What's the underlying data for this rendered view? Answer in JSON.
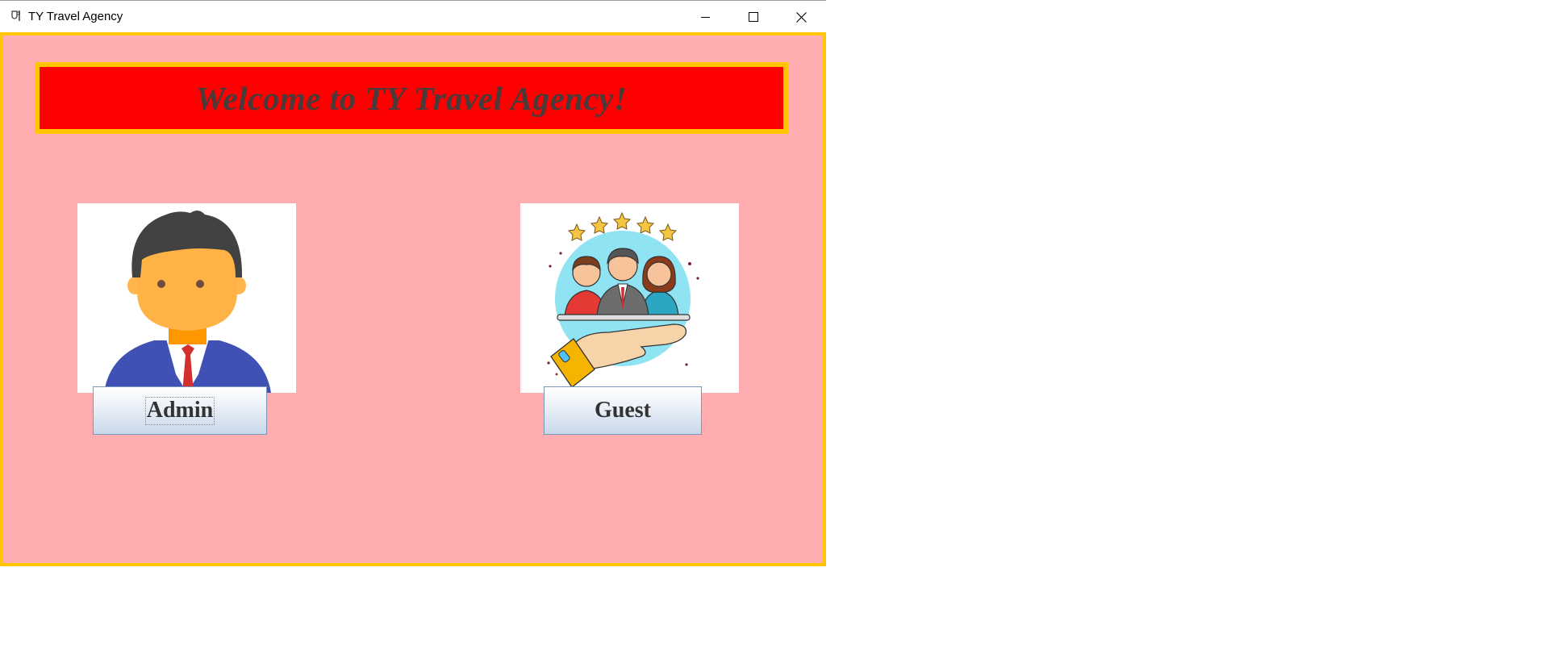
{
  "window": {
    "title": "TY Travel Agency",
    "icons": {
      "app": "java-cup-icon",
      "minimize": "minimize-icon",
      "maximize": "maximize-icon",
      "close": "close-icon"
    }
  },
  "banner": {
    "text": "Welcome to TY Travel Agency!"
  },
  "admin": {
    "image": "admin-avatar-image",
    "button_label": "Admin"
  },
  "guest": {
    "image": "guest-customers-image",
    "button_label": "Guest"
  },
  "colors": {
    "background": "#ffadb0",
    "border": "#ffc600",
    "banner": "#ff0000",
    "banner_text": "#4a3a3a"
  }
}
